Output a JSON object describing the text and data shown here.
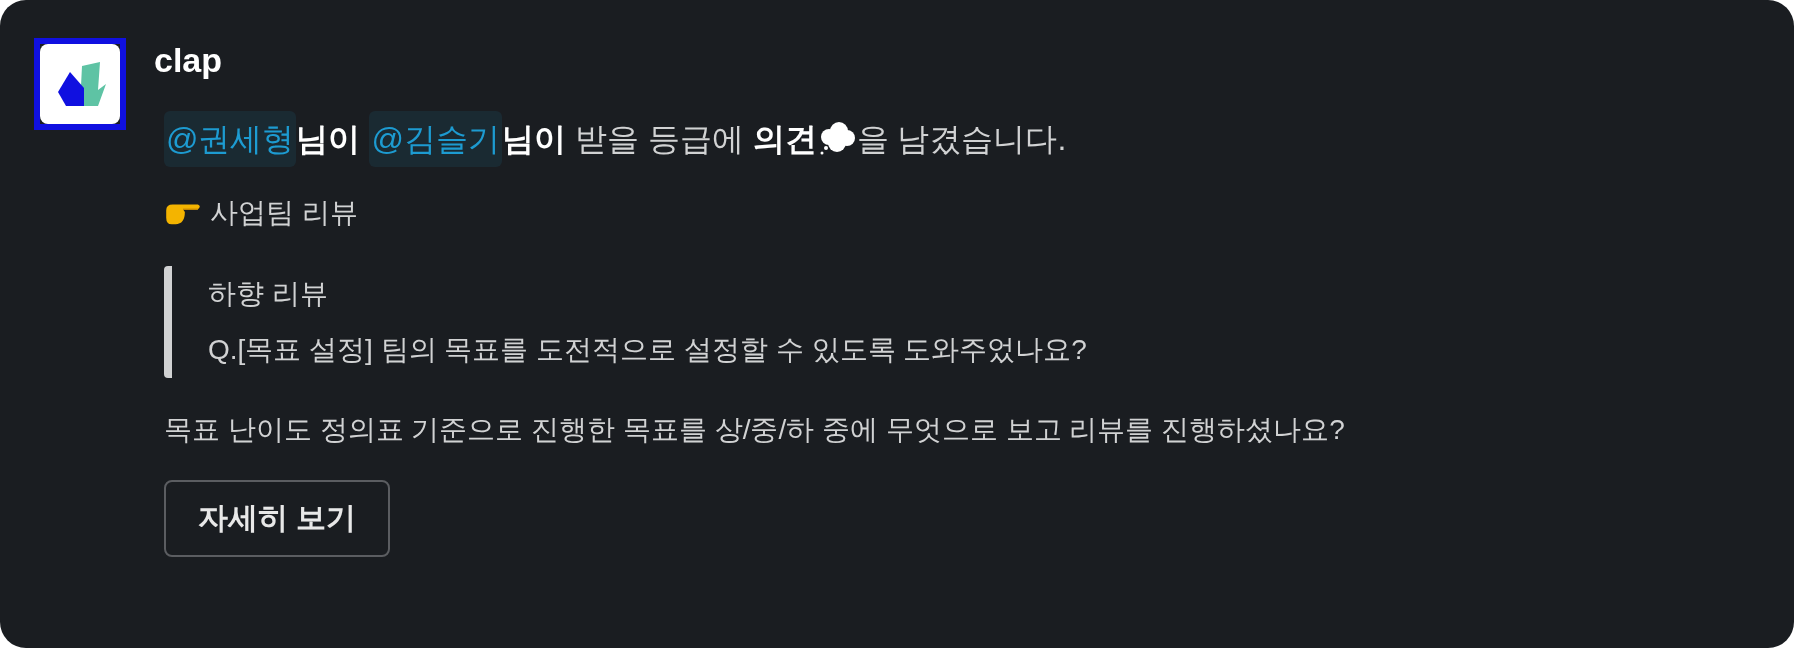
{
  "sender": {
    "name": "clap"
  },
  "message": [
    {
      "kind": "mention",
      "text": "@권세형"
    },
    {
      "kind": "text",
      "text": "**님이** "
    },
    {
      "kind": "mention",
      "text": "@김슬기"
    },
    {
      "kind": "text",
      "text": "**님이** 받을 등급에 **의견**"
    },
    {
      "kind": "icon"
    },
    {
      "kind": "text",
      "text": "을 남겼습니다."
    }
  ],
  "section": {
    "title": "사업팀 리뷰"
  },
  "quote": [
    "하향 리뷰",
    "Q.[목표 설정] 팀의 목표를 도전적으로 설정할 수 있도록 도와주었나요?"
  ],
  "question": "목표 난이도 정의표 기준으로 진행한 목표를 상/중/하 중에 무엇으로 보고 리뷰를 진행하셨나요?",
  "button": {
    "label": "자세히 보기"
  }
}
